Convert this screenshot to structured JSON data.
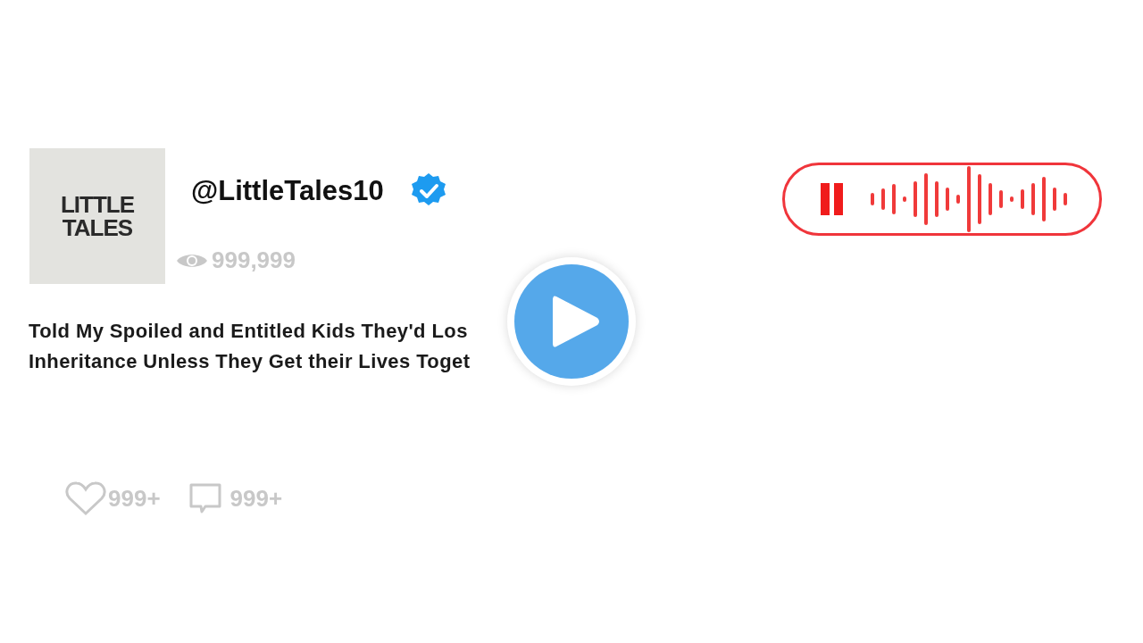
{
  "channel": {
    "logo_lines": [
      "LITTLE",
      "TALES"
    ],
    "handle": "@LittleTales10",
    "verified": true,
    "views": "999,999"
  },
  "title_lines": [
    "Told My Spoiled and Entitled Kids They'd Los",
    "Inheritance Unless They Get their Lives Toget"
  ],
  "stats": {
    "likes": "999+",
    "comments": "999+"
  },
  "audio": {
    "playing": true
  }
}
